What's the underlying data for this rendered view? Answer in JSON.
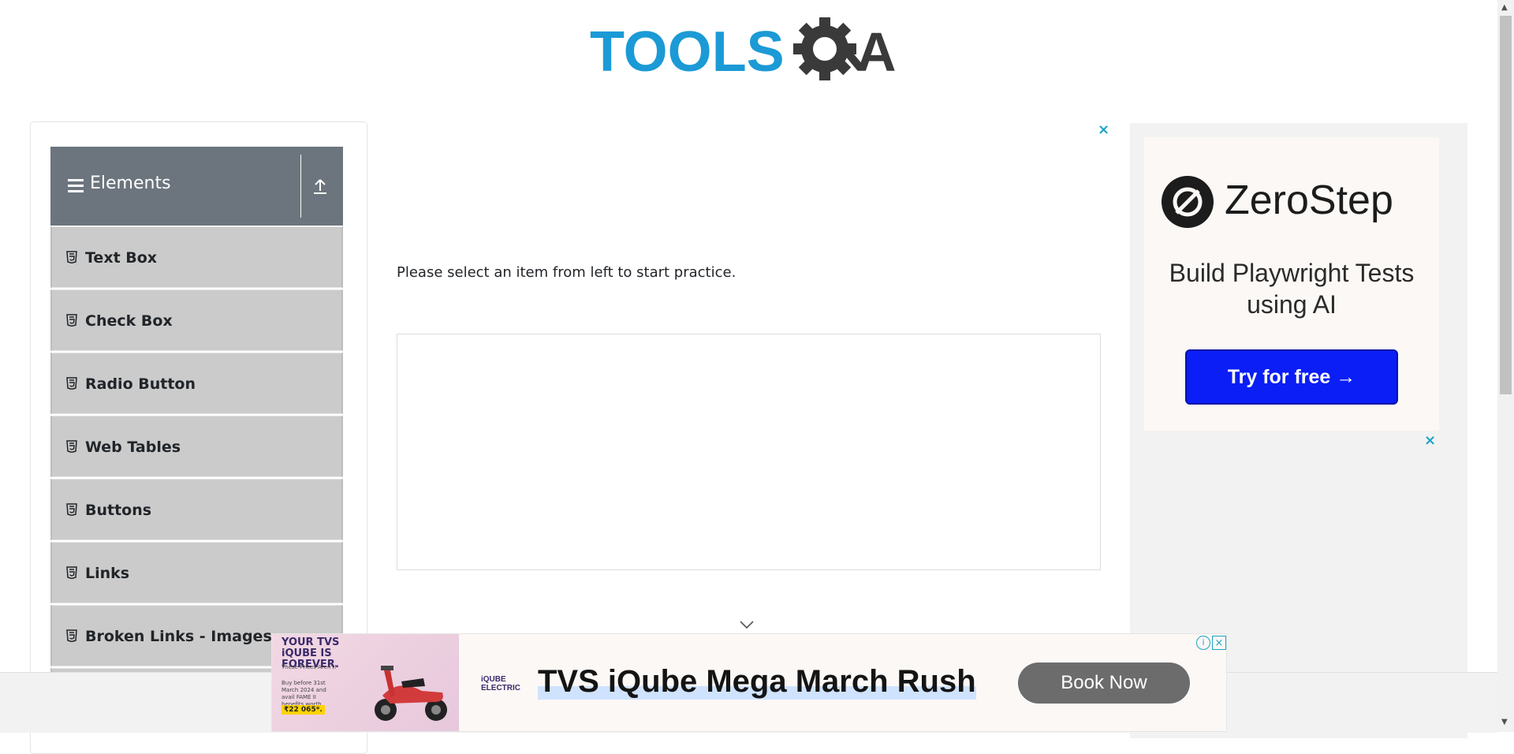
{
  "header": {
    "logo_text_left": "TOOLS",
    "logo_text_right": "A",
    "logo_colors": {
      "tools": "#1b9ad6",
      "gear": "#3a3a3a"
    }
  },
  "sidebar": {
    "group_title": "Elements",
    "group_header_color": "#6c757d",
    "item_bg": "#cbcbcb",
    "items": [
      {
        "label": "Text Box"
      },
      {
        "label": "Check Box"
      },
      {
        "label": "Radio Button"
      },
      {
        "label": "Web Tables"
      },
      {
        "label": "Buttons"
      },
      {
        "label": "Links"
      },
      {
        "label": "Broken Links - Images"
      },
      {
        "label": ""
      }
    ]
  },
  "main": {
    "instruction": "Please select an item from left to start practice.",
    "ad_close": "×"
  },
  "right_ad": {
    "brand": "ZeroStep",
    "headline": "Build Playwright Tests using AI",
    "button_label": "Try for free →",
    "button_color": "#0a1ef5",
    "close": "×"
  },
  "bottom_banner": {
    "promo_line": "YOUR TVS iQUBE IS FOREVER.",
    "promo_sub": "These Prices Aren't!",
    "promo_detail": "Buy before 31st March 2024 and avail FAME II benefits worth",
    "promo_price": "₹22 065*.",
    "brand_small": "iQUBE ELECTRIC",
    "headline": "TVS iQube Mega March Rush",
    "button_label": "Book Now",
    "info": "i",
    "close": "×"
  }
}
